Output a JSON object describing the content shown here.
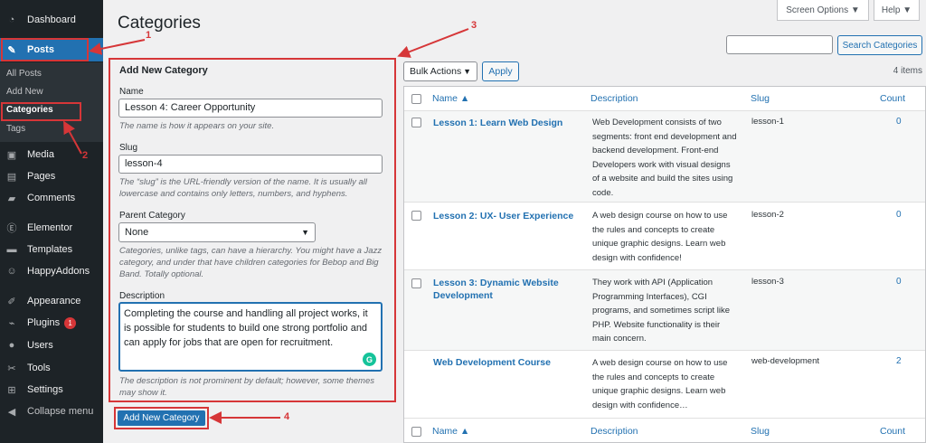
{
  "sidebar": {
    "items": [
      {
        "label": "Dashboard",
        "icon": "gauge-icon"
      },
      {
        "label": "Posts",
        "icon": "pin-icon"
      },
      {
        "label": "Media",
        "icon": "media-icon"
      },
      {
        "label": "Pages",
        "icon": "page-icon"
      },
      {
        "label": "Comments",
        "icon": "comment-icon"
      },
      {
        "label": "Elementor",
        "icon": "elementor-icon"
      },
      {
        "label": "Templates",
        "icon": "folder-icon"
      },
      {
        "label": "HappyAddons",
        "icon": "happy-icon"
      },
      {
        "label": "Appearance",
        "icon": "brush-icon"
      },
      {
        "label": "Plugins",
        "icon": "plug-icon",
        "badge": "1"
      },
      {
        "label": "Users",
        "icon": "user-icon"
      },
      {
        "label": "Tools",
        "icon": "wrench-icon"
      },
      {
        "label": "Settings",
        "icon": "settings-icon"
      },
      {
        "label": "Collapse menu",
        "icon": "collapse-icon"
      }
    ],
    "submenu": [
      "All Posts",
      "Add New",
      "Categories",
      "Tags"
    ]
  },
  "header": {
    "title": "Categories",
    "screen_options": "Screen Options ▼",
    "help": "Help ▼",
    "search_button": "Search Categories"
  },
  "form": {
    "heading": "Add New Category",
    "name_label": "Name",
    "name_value": "Lesson 4: Career Opportunity",
    "name_hint": "The name is how it appears on your site.",
    "slug_label": "Slug",
    "slug_value": "lesson-4",
    "slug_hint": "The “slug” is the URL-friendly version of the name. It is usually all lowercase and contains only letters, numbers, and hyphens.",
    "parent_label": "Parent Category",
    "parent_value": "None",
    "parent_hint": "Categories, unlike tags, can have a hierarchy. You might have a Jazz category, and under that have children categories for Bebop and Big Band. Totally optional.",
    "description_label": "Description",
    "description_value": "Completing the course and handling all project works, it is possible for students to build one strong portfolio and can apply for jobs that are open for recruitment.",
    "description_hint": "The description is not prominent by default; however, some themes may show it.",
    "submit_label": "Add New Category"
  },
  "table": {
    "bulk_actions": "Bulk Actions",
    "apply": "Apply",
    "items_count": "4 items",
    "columns": {
      "name": "Name ▲",
      "description": "Description",
      "slug": "Slug",
      "count": "Count"
    },
    "rows": [
      {
        "name": "Lesson 1: Learn Web Design",
        "description": "Web Development consists of two segments: front end development and backend development. Front-end Developers work with visual designs of a website and build the sites using code.",
        "slug": "lesson-1",
        "count": "0"
      },
      {
        "name": "Lesson 2: UX- User Experience",
        "description": "A web design course on how to use the rules and concepts to create unique graphic designs. Learn web design with confidence!",
        "slug": "lesson-2",
        "count": "0"
      },
      {
        "name": "Lesson 3: Dynamic Website Development",
        "description": "They work with API (Application Programming Interfaces), CGI programs, and sometimes script like PHP. Website functionality is their main concern.",
        "slug": "lesson-3",
        "count": "0"
      },
      {
        "name": "Web Development Course",
        "description": "A web design course on how to use the rules and concepts to create unique graphic designs. Learn web design with confidence…",
        "slug": "web-development",
        "count": "2"
      }
    ]
  },
  "annotations": {
    "n1": "1",
    "n2": "2",
    "n3": "3",
    "n4": "4"
  }
}
